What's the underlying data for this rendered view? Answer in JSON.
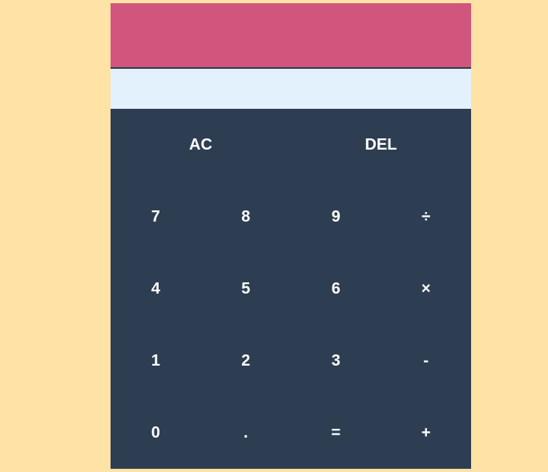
{
  "colors": {
    "background": "#fee2a6",
    "display_result": "#d2557e",
    "display_input": "#e3f1fd",
    "keypad": "#2e3e52",
    "key_text": "#ffffff"
  },
  "display": {
    "result": "",
    "input": ""
  },
  "keys": {
    "ac": "AC",
    "del": "DEL",
    "seven": "7",
    "eight": "8",
    "nine": "9",
    "divide": "÷",
    "four": "4",
    "five": "5",
    "six": "6",
    "multiply": "×",
    "one": "1",
    "two": "2",
    "three": "3",
    "subtract": "-",
    "zero": "0",
    "decimal": ".",
    "equals": "=",
    "add": "+"
  }
}
